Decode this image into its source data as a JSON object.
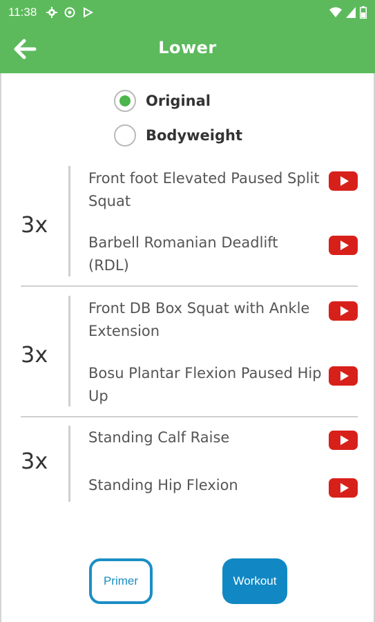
{
  "status_bar": {
    "time": "11:38",
    "left_icons": [
      "settings-icon",
      "vpn-icon",
      "play-icon"
    ],
    "right_icons": [
      "wifi-icon",
      "signal-icon",
      "battery-icon"
    ]
  },
  "app_bar": {
    "title": "Lower",
    "back_icon": "arrow-left-icon",
    "background": "#5cba5c"
  },
  "mode_options": [
    {
      "label": "Original",
      "selected": true
    },
    {
      "label": "Bodyweight",
      "selected": false
    }
  ],
  "groups": [
    {
      "sets": "3x",
      "exercises": [
        {
          "name": "Front foot Elevated Paused Split Squat"
        },
        {
          "name": "Barbell Romanian Deadlift (RDL)"
        }
      ]
    },
    {
      "sets": "3x",
      "exercises": [
        {
          "name": "Front DB Box Squat with Ankle Extension"
        },
        {
          "name": "Bosu Plantar Flexion Paused Hip Up"
        }
      ]
    },
    {
      "sets": "3x",
      "exercises": [
        {
          "name": "Standing Calf Raise"
        },
        {
          "name": "Standing Hip Flexion"
        }
      ]
    }
  ],
  "buttons": {
    "primer": "Primer",
    "workout": "Workout"
  },
  "colors": {
    "accent_green": "#5cba5c",
    "youtube_red": "#d8201b",
    "button_blue": "#1188c4"
  }
}
